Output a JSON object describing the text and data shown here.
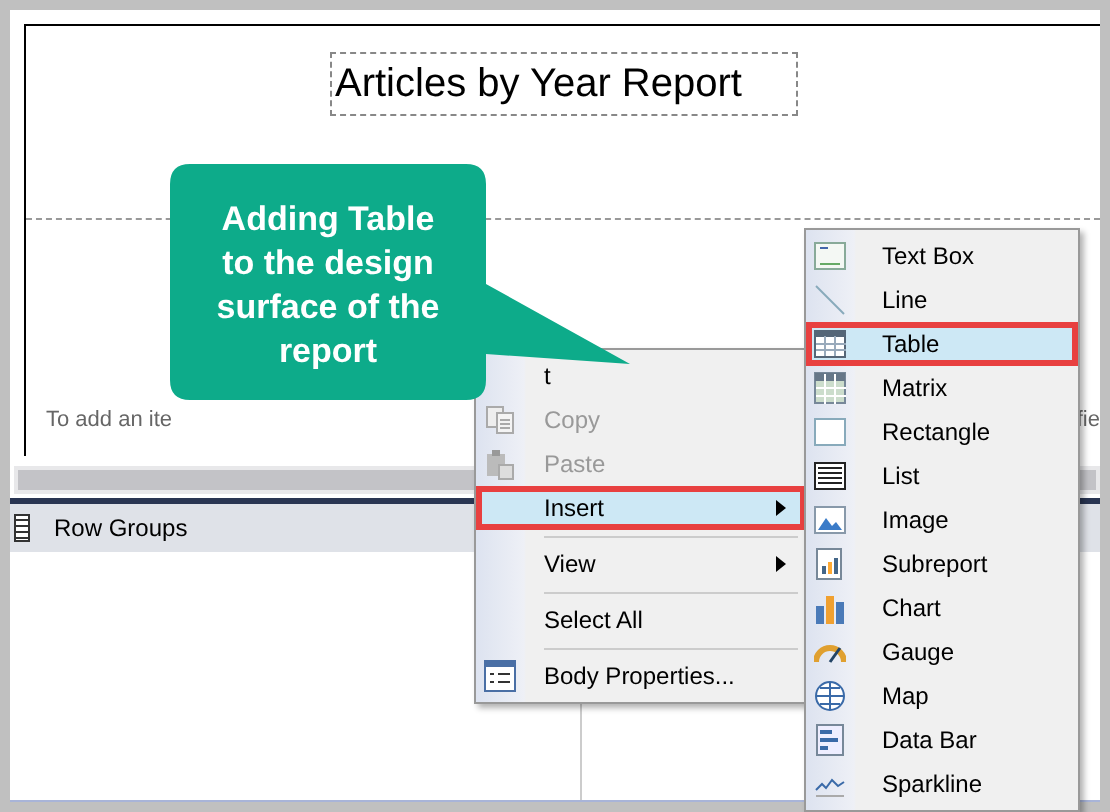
{
  "report": {
    "title": "Articles by Year Report",
    "hint_left": "To add an ite",
    "hint_right": "fie"
  },
  "callout": {
    "text": "Adding Table to the design surface of the report"
  },
  "row_groups": {
    "label": "Row Groups"
  },
  "context_menu": {
    "items": [
      {
        "label": "t",
        "disabled": false,
        "selected": false,
        "submenu": false,
        "separator_after": false
      },
      {
        "label": "Copy",
        "disabled": true,
        "selected": false,
        "submenu": false,
        "separator_after": false
      },
      {
        "label": "Paste",
        "disabled": true,
        "selected": false,
        "submenu": false,
        "separator_after": false
      },
      {
        "label": "Insert",
        "disabled": false,
        "selected": true,
        "submenu": true,
        "separator_after": true
      },
      {
        "label": "View",
        "disabled": false,
        "selected": false,
        "submenu": true,
        "separator_after": true
      },
      {
        "label": "Select All",
        "disabled": false,
        "selected": false,
        "submenu": false,
        "separator_after": true
      },
      {
        "label": "Body Properties...",
        "disabled": false,
        "selected": false,
        "submenu": false,
        "separator_after": false
      }
    ]
  },
  "insert_menu": {
    "items": [
      {
        "label": "Text Box",
        "selected": false
      },
      {
        "label": "Line",
        "selected": false
      },
      {
        "label": "Table",
        "selected": true
      },
      {
        "label": "Matrix",
        "selected": false
      },
      {
        "label": "Rectangle",
        "selected": false
      },
      {
        "label": "List",
        "selected": false
      },
      {
        "label": "Image",
        "selected": false
      },
      {
        "label": "Subreport",
        "selected": false
      },
      {
        "label": "Chart",
        "selected": false
      },
      {
        "label": "Gauge",
        "selected": false
      },
      {
        "label": "Map",
        "selected": false
      },
      {
        "label": "Data Bar",
        "selected": false
      },
      {
        "label": "Sparkline",
        "selected": false
      }
    ]
  }
}
